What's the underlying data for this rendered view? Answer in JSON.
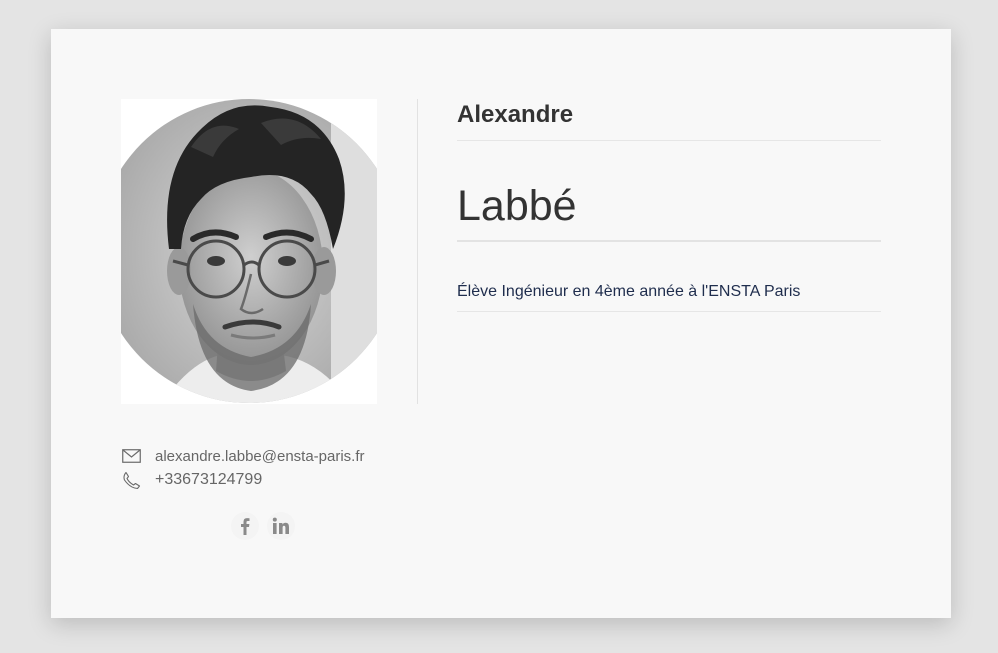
{
  "profile": {
    "first_name": "Alexandre",
    "last_name": "Labbé",
    "job_title": "Élève Ingénieur en 4ème année à l'ENSTA Paris",
    "photo_alt": "Alexandre Labbé"
  },
  "contact": {
    "email": "alexandre.labbe@ensta-paris.fr",
    "phone": "+33673124799"
  },
  "social": [
    {
      "name": "facebook",
      "icon": "facebook-icon"
    },
    {
      "name": "linkedin",
      "icon": "linkedin-icon"
    }
  ],
  "colors": {
    "background": "#e4e4e4",
    "card": "#f8f8f8",
    "name_text": "#333333",
    "job_text": "#1f2d4d",
    "contact_text": "#666666",
    "icon_gray": "#8a8a8a"
  }
}
